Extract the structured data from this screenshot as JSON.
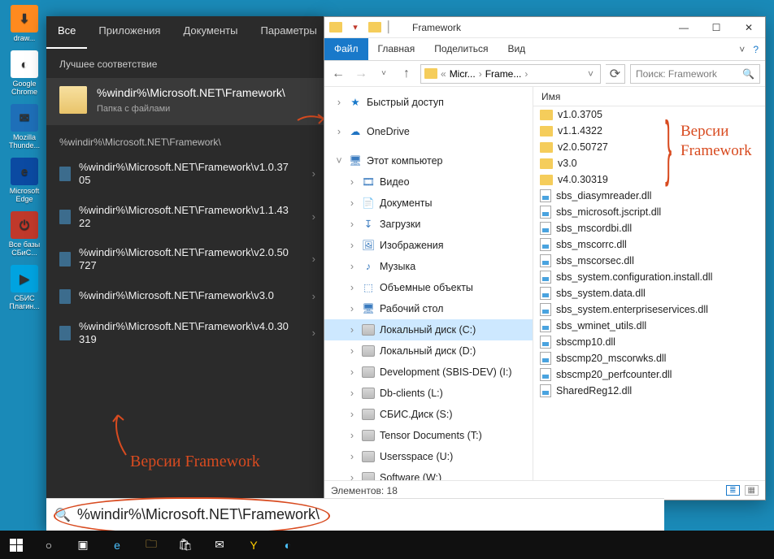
{
  "desktop": {
    "icons": [
      {
        "label": "draw...",
        "bg": "#ff8a1f",
        "glyph": "⬇"
      },
      {
        "label": "Google Chrome",
        "bg": "#ffffff",
        "glyph": "◐"
      },
      {
        "label": "Mozilla Thunde...",
        "bg": "#1e6fb8",
        "glyph": "✉"
      },
      {
        "label": "Microsoft Edge",
        "bg": "#0b4aa2",
        "glyph": "e"
      },
      {
        "label": "Все базы СБиС...",
        "bg": "#c0392b",
        "glyph": "⏻"
      },
      {
        "label": "СБИС Плагин...",
        "bg": "#00a3e0",
        "glyph": "▶"
      }
    ]
  },
  "startPanel": {
    "tabs": [
      "Все",
      "Приложения",
      "Документы",
      "Параметры"
    ],
    "activeTab": 0,
    "bestMatchHeader": "Лучшее соответствие",
    "bestMatch": {
      "title": "%windir%\\Microsoft.NET\\Framework\\",
      "subtitle": "Папка с файлами"
    },
    "groupTitle": "%windir%\\Microsoft.NET\\Framework\\",
    "results": [
      "%windir%\\Microsoft.NET\\Framework\\v1.0.3705",
      "%windir%\\Microsoft.NET\\Framework\\v1.1.4322",
      "%windir%\\Microsoft.NET\\Framework\\v2.0.50727",
      "%windir%\\Microsoft.NET\\Framework\\v3.0",
      "%windir%\\Microsoft.NET\\Framework\\v4.0.30319"
    ],
    "annotation": "Версии Framework"
  },
  "explorer": {
    "title": "Framework",
    "ribbon": {
      "file": "Файл",
      "tabs": [
        "Главная",
        "Поделиться",
        "Вид"
      ]
    },
    "address": {
      "crumbs": [
        "Micr...",
        "Frame..."
      ]
    },
    "search": {
      "placeholder": "Поиск: Framework"
    },
    "navTree": {
      "quickAccess": "Быстрый доступ",
      "oneDrive": "OneDrive",
      "thisPc": "Этот компьютер",
      "folders": [
        "Видео",
        "Документы",
        "Загрузки",
        "Изображения",
        "Музыка",
        "Объемные объекты",
        "Рабочий стол"
      ],
      "drives": [
        {
          "label": "Локальный диск (C:)",
          "selected": true
        },
        {
          "label": "Локальный диск (D:)"
        },
        {
          "label": "Development (SBIS-DEV) (I:)"
        },
        {
          "label": "Db-clients (L:)"
        },
        {
          "label": "СБИС.Диск (S:)"
        },
        {
          "label": "Tensor Documents (T:)"
        },
        {
          "label": "Usersspace (U:)"
        },
        {
          "label": "Software (W:)"
        }
      ]
    },
    "listHeader": "Имя",
    "files": [
      {
        "name": "v1.0.3705",
        "type": "folder"
      },
      {
        "name": "v1.1.4322",
        "type": "folder"
      },
      {
        "name": "v2.0.50727",
        "type": "folder"
      },
      {
        "name": "v3.0",
        "type": "folder"
      },
      {
        "name": "v4.0.30319",
        "type": "folder"
      },
      {
        "name": "sbs_diasymreader.dll",
        "type": "dll"
      },
      {
        "name": "sbs_microsoft.jscript.dll",
        "type": "dll"
      },
      {
        "name": "sbs_mscordbi.dll",
        "type": "dll"
      },
      {
        "name": "sbs_mscorrc.dll",
        "type": "dll"
      },
      {
        "name": "sbs_mscorsec.dll",
        "type": "dll"
      },
      {
        "name": "sbs_system.configuration.install.dll",
        "type": "dll"
      },
      {
        "name": "sbs_system.data.dll",
        "type": "dll"
      },
      {
        "name": "sbs_system.enterpriseservices.dll",
        "type": "dll"
      },
      {
        "name": "sbs_wminet_utils.dll",
        "type": "dll"
      },
      {
        "name": "sbscmp10.dll",
        "type": "dll"
      },
      {
        "name": "sbscmp20_mscorwks.dll",
        "type": "dll"
      },
      {
        "name": "sbscmp20_perfcounter.dll",
        "type": "dll"
      },
      {
        "name": "SharedReg12.dll",
        "type": "dll"
      }
    ],
    "status": "Элементов: 18",
    "annotation": "Версии Framework"
  },
  "taskSearch": {
    "value": "%windir%\\Microsoft.NET\\Framework\\"
  },
  "taskbar": {
    "items": [
      {
        "name": "task-view",
        "glyph": "▣"
      },
      {
        "name": "edge",
        "glyph": "e",
        "color": "#4cc2ff"
      },
      {
        "name": "explorer",
        "glyph": "🗀",
        "color": "#f3c04b"
      },
      {
        "name": "store",
        "glyph": "🛍",
        "color": "#ffffff"
      },
      {
        "name": "mail",
        "glyph": "✉",
        "color": "#ffffff"
      },
      {
        "name": "yandex",
        "glyph": "Y",
        "color": "#ffcc00"
      },
      {
        "name": "chrome",
        "glyph": "◐",
        "color": "#4cc2ff"
      }
    ]
  }
}
